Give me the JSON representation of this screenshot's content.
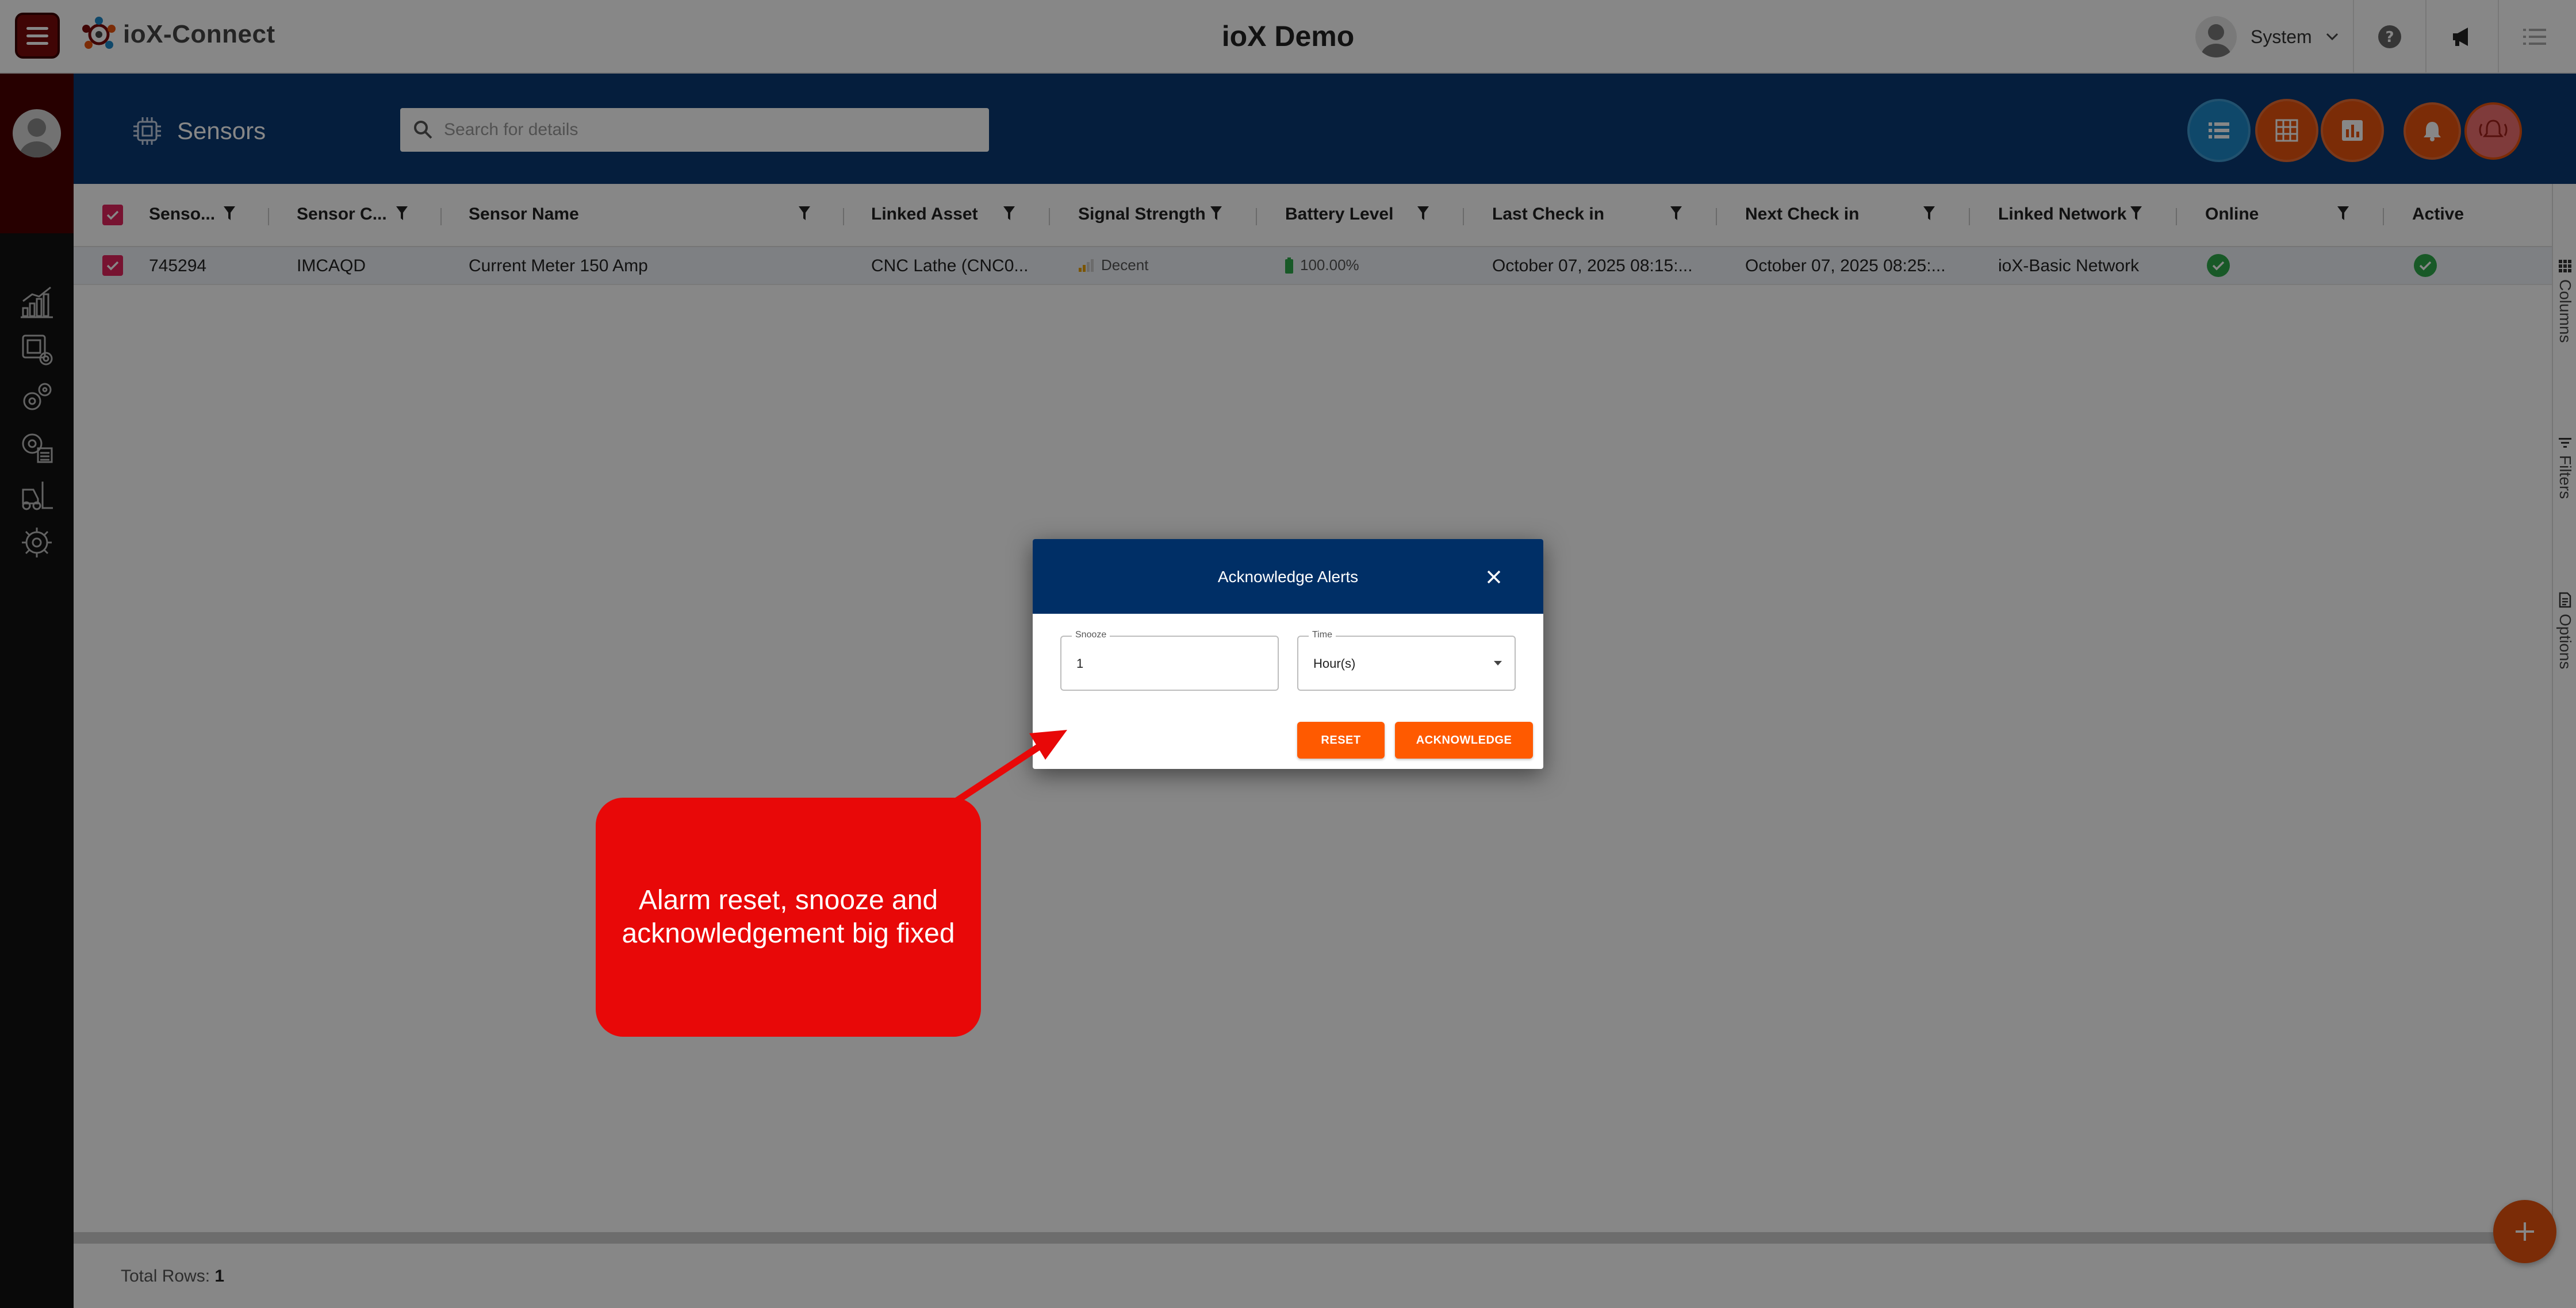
{
  "app": {
    "brand_name": "ioX-Connect",
    "title": "ioX Demo",
    "user_name": "System"
  },
  "header": {
    "page_title": "Sensors",
    "search_placeholder": "Search for details"
  },
  "grid": {
    "columns": [
      "Senso...",
      "Sensor C...",
      "Sensor Name",
      "Linked Asset",
      "Signal Strength",
      "Battery Level",
      "Last Check in",
      "Next Check in",
      "Linked Network",
      "Online",
      "Active"
    ],
    "rows": [
      {
        "sensor_id": "745294",
        "sensor_code": "IMCAQD",
        "sensor_name": "Current Meter 150 Amp",
        "linked_asset": "CNC Lathe (CNC0...",
        "signal_strength": "Decent",
        "battery_level": "100.00%",
        "last_check_in": "October 07, 2025 08:15:...",
        "next_check_in": "October 07, 2025 08:25:...",
        "linked_network": "ioX-Basic Network",
        "online": true,
        "active": true
      }
    ],
    "total_rows_label": "Total Rows:",
    "total_rows_value": "1"
  },
  "side_panel": {
    "tabs": [
      "Columns",
      "Filters",
      "Options"
    ]
  },
  "dialog": {
    "title": "Acknowledge Alerts",
    "snooze_label": "Snooze",
    "snooze_value": "1",
    "time_label": "Time",
    "time_value": "Hour(s)",
    "reset_label": "RESET",
    "acknowledge_label": "ACKNOWLEDGE"
  },
  "annotation": {
    "text": "Alarm reset, snooze and acknowledgement big fixed"
  },
  "colors": {
    "brand_dark_red": "#7a0a0a",
    "header_navy": "#0b3a73",
    "dialog_navy": "#002f66",
    "accent_orange": "#ff5a00",
    "accent_blue": "#1e88c8",
    "checkbox_pink": "#e0245e",
    "online_green": "#2ea94a",
    "callout_red": "#e80808"
  },
  "icons": {
    "menu": "hamburger-icon",
    "search": "search-icon",
    "sensors": "chip-icon",
    "help": "help-icon",
    "announcement": "megaphone-icon",
    "list": "list-icon",
    "close": "close-icon",
    "fab": "plus-icon"
  }
}
